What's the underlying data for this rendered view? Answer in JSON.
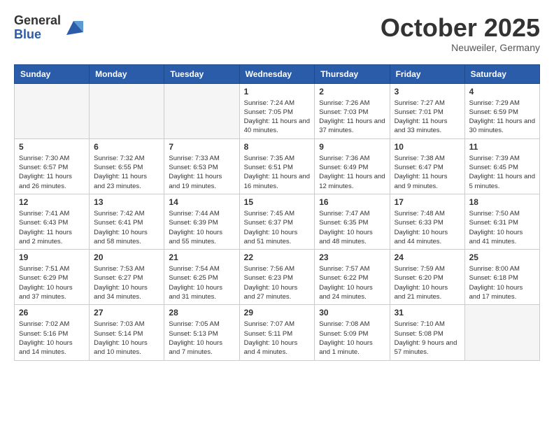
{
  "logo": {
    "general": "General",
    "blue": "Blue"
  },
  "title": "October 2025",
  "location": "Neuweiler, Germany",
  "days_header": [
    "Sunday",
    "Monday",
    "Tuesday",
    "Wednesday",
    "Thursday",
    "Friday",
    "Saturday"
  ],
  "weeks": [
    [
      {
        "day": "",
        "info": ""
      },
      {
        "day": "",
        "info": ""
      },
      {
        "day": "",
        "info": ""
      },
      {
        "day": "1",
        "info": "Sunrise: 7:24 AM\nSunset: 7:05 PM\nDaylight: 11 hours and 40 minutes."
      },
      {
        "day": "2",
        "info": "Sunrise: 7:26 AM\nSunset: 7:03 PM\nDaylight: 11 hours and 37 minutes."
      },
      {
        "day": "3",
        "info": "Sunrise: 7:27 AM\nSunset: 7:01 PM\nDaylight: 11 hours and 33 minutes."
      },
      {
        "day": "4",
        "info": "Sunrise: 7:29 AM\nSunset: 6:59 PM\nDaylight: 11 hours and 30 minutes."
      }
    ],
    [
      {
        "day": "5",
        "info": "Sunrise: 7:30 AM\nSunset: 6:57 PM\nDaylight: 11 hours and 26 minutes."
      },
      {
        "day": "6",
        "info": "Sunrise: 7:32 AM\nSunset: 6:55 PM\nDaylight: 11 hours and 23 minutes."
      },
      {
        "day": "7",
        "info": "Sunrise: 7:33 AM\nSunset: 6:53 PM\nDaylight: 11 hours and 19 minutes."
      },
      {
        "day": "8",
        "info": "Sunrise: 7:35 AM\nSunset: 6:51 PM\nDaylight: 11 hours and 16 minutes."
      },
      {
        "day": "9",
        "info": "Sunrise: 7:36 AM\nSunset: 6:49 PM\nDaylight: 11 hours and 12 minutes."
      },
      {
        "day": "10",
        "info": "Sunrise: 7:38 AM\nSunset: 6:47 PM\nDaylight: 11 hours and 9 minutes."
      },
      {
        "day": "11",
        "info": "Sunrise: 7:39 AM\nSunset: 6:45 PM\nDaylight: 11 hours and 5 minutes."
      }
    ],
    [
      {
        "day": "12",
        "info": "Sunrise: 7:41 AM\nSunset: 6:43 PM\nDaylight: 11 hours and 2 minutes."
      },
      {
        "day": "13",
        "info": "Sunrise: 7:42 AM\nSunset: 6:41 PM\nDaylight: 10 hours and 58 minutes."
      },
      {
        "day": "14",
        "info": "Sunrise: 7:44 AM\nSunset: 6:39 PM\nDaylight: 10 hours and 55 minutes."
      },
      {
        "day": "15",
        "info": "Sunrise: 7:45 AM\nSunset: 6:37 PM\nDaylight: 10 hours and 51 minutes."
      },
      {
        "day": "16",
        "info": "Sunrise: 7:47 AM\nSunset: 6:35 PM\nDaylight: 10 hours and 48 minutes."
      },
      {
        "day": "17",
        "info": "Sunrise: 7:48 AM\nSunset: 6:33 PM\nDaylight: 10 hours and 44 minutes."
      },
      {
        "day": "18",
        "info": "Sunrise: 7:50 AM\nSunset: 6:31 PM\nDaylight: 10 hours and 41 minutes."
      }
    ],
    [
      {
        "day": "19",
        "info": "Sunrise: 7:51 AM\nSunset: 6:29 PM\nDaylight: 10 hours and 37 minutes."
      },
      {
        "day": "20",
        "info": "Sunrise: 7:53 AM\nSunset: 6:27 PM\nDaylight: 10 hours and 34 minutes."
      },
      {
        "day": "21",
        "info": "Sunrise: 7:54 AM\nSunset: 6:25 PM\nDaylight: 10 hours and 31 minutes."
      },
      {
        "day": "22",
        "info": "Sunrise: 7:56 AM\nSunset: 6:23 PM\nDaylight: 10 hours and 27 minutes."
      },
      {
        "day": "23",
        "info": "Sunrise: 7:57 AM\nSunset: 6:22 PM\nDaylight: 10 hours and 24 minutes."
      },
      {
        "day": "24",
        "info": "Sunrise: 7:59 AM\nSunset: 6:20 PM\nDaylight: 10 hours and 21 minutes."
      },
      {
        "day": "25",
        "info": "Sunrise: 8:00 AM\nSunset: 6:18 PM\nDaylight: 10 hours and 17 minutes."
      }
    ],
    [
      {
        "day": "26",
        "info": "Sunrise: 7:02 AM\nSunset: 5:16 PM\nDaylight: 10 hours and 14 minutes."
      },
      {
        "day": "27",
        "info": "Sunrise: 7:03 AM\nSunset: 5:14 PM\nDaylight: 10 hours and 10 minutes."
      },
      {
        "day": "28",
        "info": "Sunrise: 7:05 AM\nSunset: 5:13 PM\nDaylight: 10 hours and 7 minutes."
      },
      {
        "day": "29",
        "info": "Sunrise: 7:07 AM\nSunset: 5:11 PM\nDaylight: 10 hours and 4 minutes."
      },
      {
        "day": "30",
        "info": "Sunrise: 7:08 AM\nSunset: 5:09 PM\nDaylight: 10 hours and 1 minute."
      },
      {
        "day": "31",
        "info": "Sunrise: 7:10 AM\nSunset: 5:08 PM\nDaylight: 9 hours and 57 minutes."
      },
      {
        "day": "",
        "info": ""
      }
    ]
  ]
}
